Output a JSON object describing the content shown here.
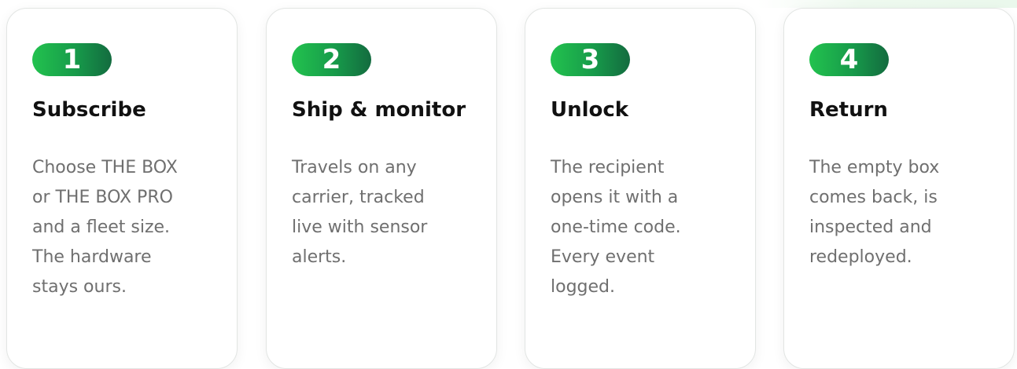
{
  "steps": [
    {
      "number": "1",
      "title": "Subscribe",
      "description_lines": [
        "Choose THE BOX",
        "or THE BOX PRO",
        "and a fleet size.",
        "The hardware",
        "stays ours."
      ]
    },
    {
      "number": "2",
      "title": "Ship & monitor",
      "description_lines": [
        "Travels on any",
        "carrier, tracked",
        "live with sensor",
        "alerts."
      ]
    },
    {
      "number": "3",
      "title": "Unlock",
      "description_lines": [
        "The recipient",
        "opens it with a",
        "one-time code.",
        "Every event",
        "logged."
      ]
    },
    {
      "number": "4",
      "title": "Return",
      "description_lines": [
        "The empty box",
        "comes back, is",
        "inspected and",
        "redeployed."
      ]
    }
  ],
  "colors": {
    "badge_gradient_start": "#22c24e",
    "badge_gradient_end": "#136b3f",
    "title_text": "#111111",
    "description_text": "#6f6f6f",
    "card_border": "#e2e5e3"
  }
}
